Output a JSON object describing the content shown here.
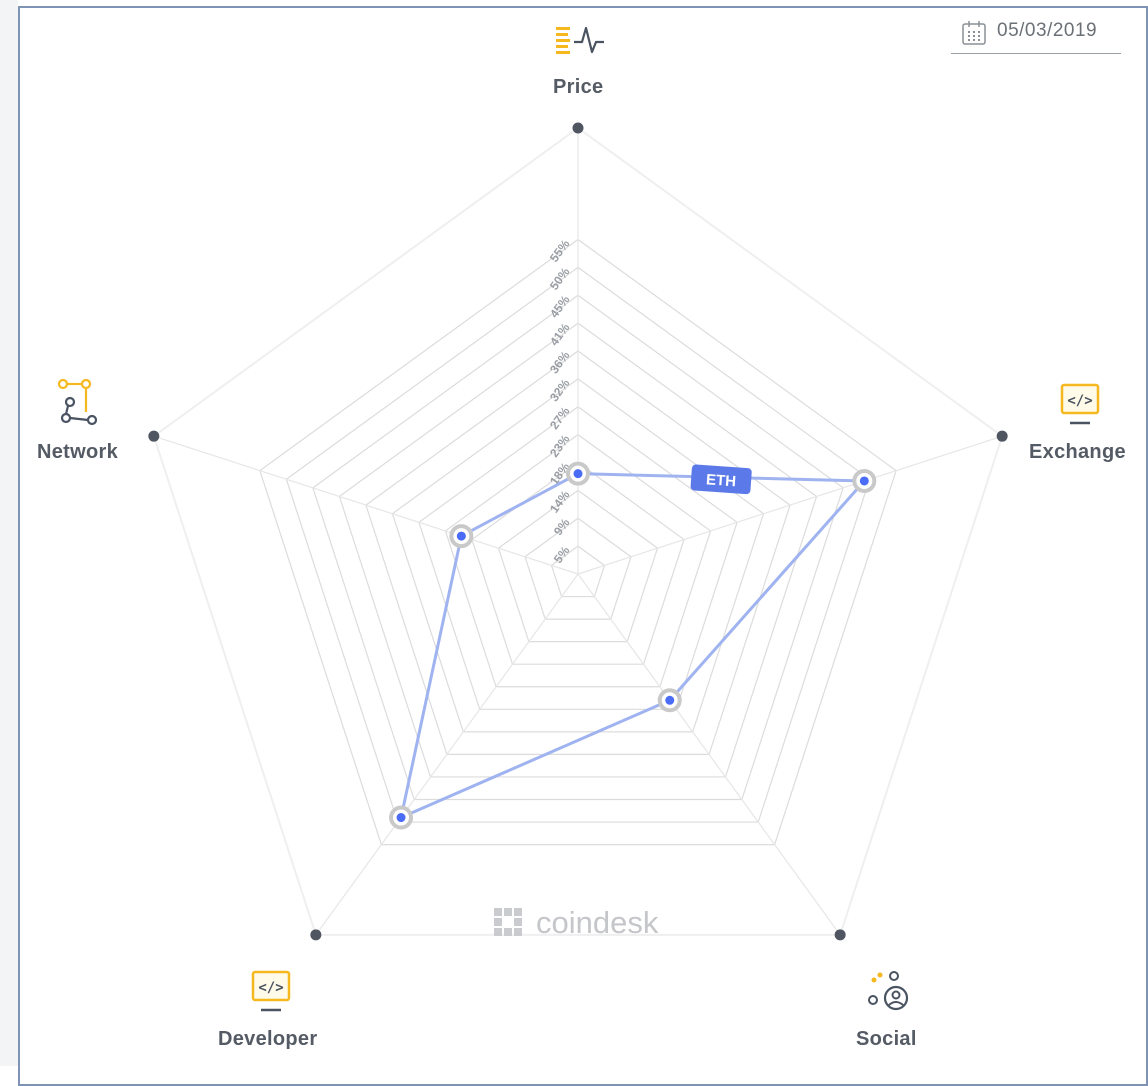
{
  "date": "05/03/2019",
  "brand": "coindesk",
  "chart_data": {
    "type": "radar",
    "axes": [
      "Price",
      "Exchange",
      "Social",
      "Developer",
      "Network"
    ],
    "tick_labels": [
      "5%",
      "9%",
      "14%",
      "18%",
      "23%",
      "27%",
      "32%",
      "36%",
      "41%",
      "45%",
      "50%",
      "55%"
    ],
    "rmax_fraction": 0.6,
    "series": [
      {
        "name": "ETH",
        "values": [
          0.18,
          0.54,
          0.28,
          0.54,
          0.22
        ],
        "color": "#9fb3f0"
      }
    ]
  },
  "colors": {
    "grid": "#dcdcdc",
    "accent_yellow": "#f5b81f",
    "dark_icon": "#4a5361",
    "point": "#4a6cf7",
    "label_bg": "#5b79e8"
  },
  "icons": {
    "price": "price-bars-wave-icon",
    "exchange": "code-monitor-icon",
    "social": "social-person-icon",
    "developer": "code-monitor-icon",
    "network": "network-nodes-icon",
    "date": "calendar-icon",
    "brand": "coindesk-logo-icon"
  }
}
